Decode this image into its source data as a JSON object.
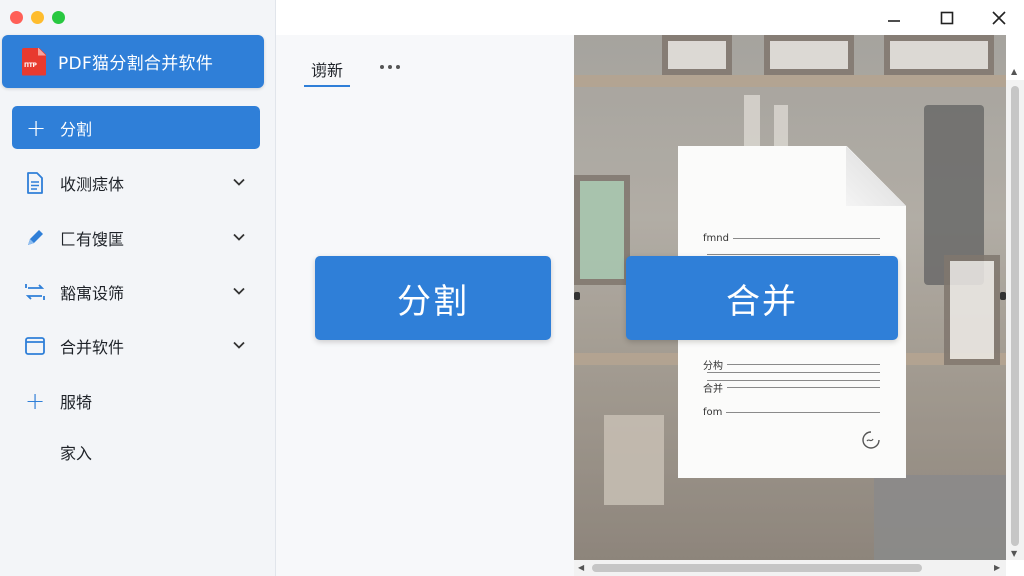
{
  "app": {
    "title": "PDF猫分割合并软件"
  },
  "sidebar": {
    "active": {
      "label": "分割",
      "icon": "plus-icon"
    },
    "items": [
      {
        "label": "收测痣体",
        "icon": "document-icon",
        "chevron": true
      },
      {
        "label": "匚有馊匩",
        "icon": "pencil-icon",
        "chevron": true
      },
      {
        "label": "豁寓设筛",
        "icon": "transfer-icon",
        "chevron": true
      },
      {
        "label": "合并软件",
        "icon": "window-icon",
        "chevron": true
      },
      {
        "label": "服犄",
        "icon": "plus-icon",
        "chevron": false
      },
      {
        "label": "家入",
        "icon": "",
        "chevron": false
      }
    ]
  },
  "tabs": {
    "refresh": "谫新",
    "more": "more-icon"
  },
  "actions": {
    "split": "分割",
    "merge": "合并"
  },
  "document": {
    "lines": [
      "fmnd",
      "",
      "",
      "分构",
      "",
      "",
      "合并",
      "fom"
    ]
  },
  "colors": {
    "accent": "#2f7fd8",
    "logo": "#e83a2f"
  }
}
